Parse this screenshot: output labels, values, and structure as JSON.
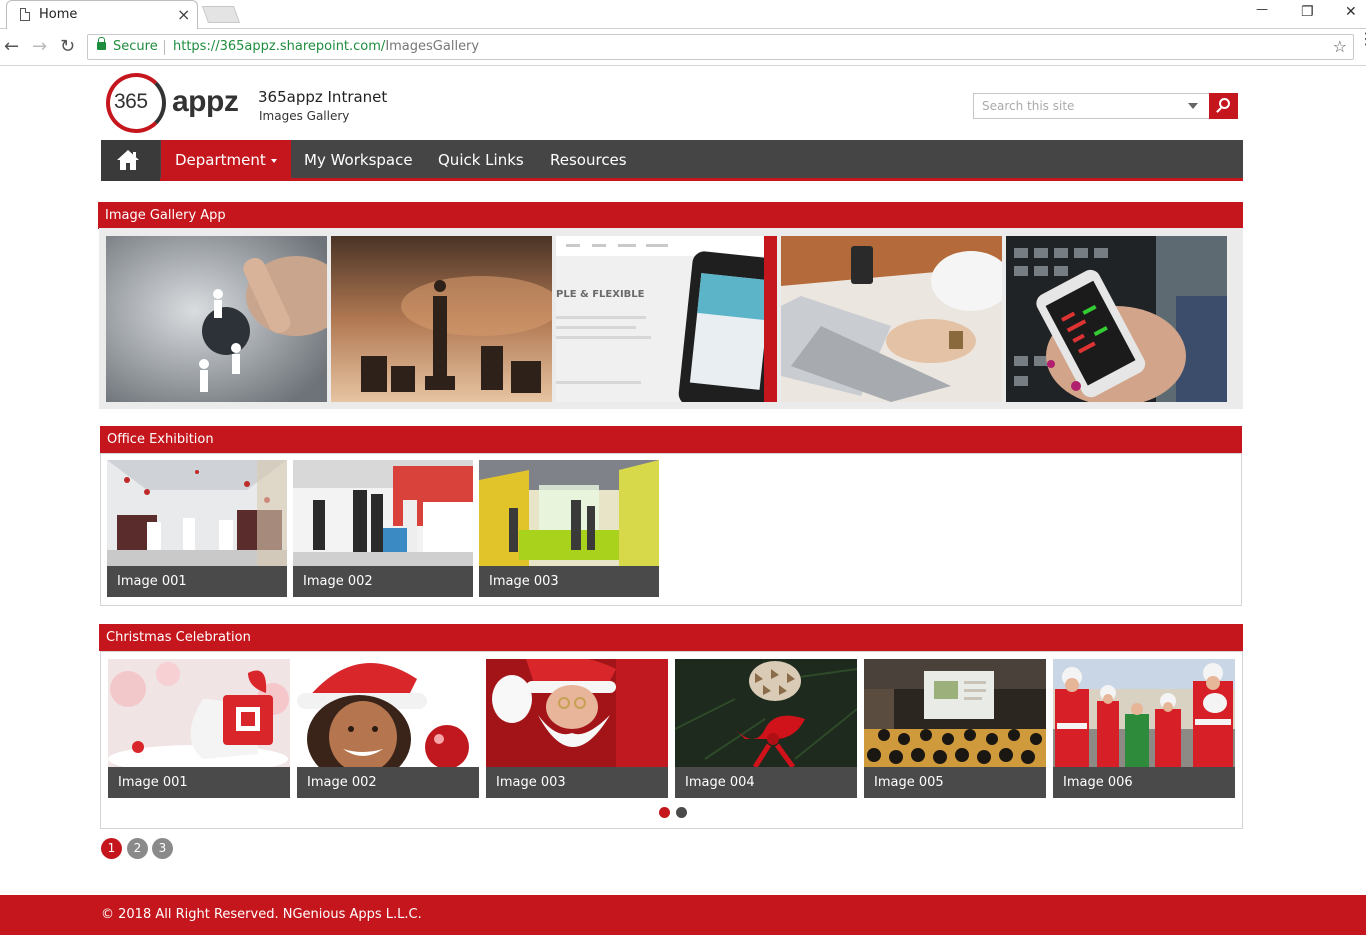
{
  "browser": {
    "tab_title": "Home",
    "tab_close": "×",
    "window_minimize": "—",
    "window_restore": "❐",
    "window_close": "✕",
    "back": "←",
    "forward": "→",
    "reload": "↻",
    "secure_label": "Secure",
    "url_host": "https://365appz.sharepoint.com/",
    "url_path": "ImagesGallery",
    "bookmark": "☆",
    "menu": "⋮"
  },
  "header": {
    "logo_number": "365",
    "logo_word": "appz",
    "site_title": "365appz Intranet",
    "site_subtitle": "Images Gallery",
    "search_placeholder": "Search this site"
  },
  "nav": {
    "items": [
      {
        "label": "Department"
      },
      {
        "label": "My Workspace"
      },
      {
        "label": "Quick Links"
      },
      {
        "label": "Resources"
      }
    ]
  },
  "sections": {
    "gallery_app": {
      "title": "Image Gallery App"
    },
    "office_exhibition": {
      "title": "Office Exhibition",
      "images": [
        {
          "caption": "Image 001"
        },
        {
          "caption": "Image 002"
        },
        {
          "caption": "Image 003"
        }
      ]
    },
    "christmas": {
      "title": "Christmas Celebration",
      "images": [
        {
          "caption": "Image 001"
        },
        {
          "caption": "Image 002"
        },
        {
          "caption": "Image 003"
        },
        {
          "caption": "Image 004"
        },
        {
          "caption": "Image 005"
        },
        {
          "caption": "Image 006"
        }
      ],
      "carousel_active": 1,
      "carousel_count": 2
    }
  },
  "pagination": {
    "pages": [
      "1",
      "2",
      "3"
    ],
    "current": "1"
  },
  "footer": {
    "text": "© 2018 All Right Reserved. NGenious Apps L.L.C."
  },
  "colors": {
    "brand_red": "#c4161c",
    "nav_gray": "#454545",
    "caption_gray": "#4a4a4a"
  }
}
